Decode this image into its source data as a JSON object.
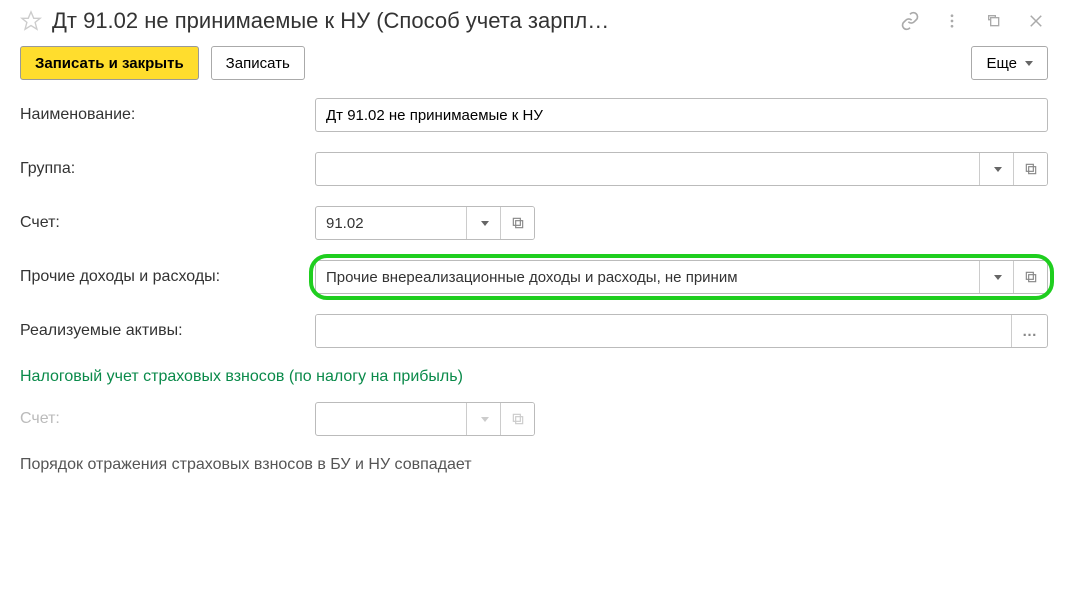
{
  "title": "Дт 91.02 не принимаемые к НУ (Способ учета зарпл…",
  "toolbar": {
    "save_close": "Записать и закрыть",
    "save": "Записать",
    "more": "Еще"
  },
  "labels": {
    "name": "Наименование:",
    "group": "Группа:",
    "account": "Счет:",
    "other_income_expense": "Прочие доходы и расходы:",
    "realizable_assets": "Реализуемые активы:",
    "tax_section": "Налоговый учет страховых взносов (по налогу на прибыль)",
    "account2": "Счет:",
    "note": "Порядок отражения страховых взносов в БУ и НУ совпадает"
  },
  "values": {
    "name": "Дт 91.02 не принимаемые к НУ",
    "group": "",
    "account": "91.02",
    "other_income_expense": "Прочие внереализационные доходы и расходы, не приним",
    "realizable_assets": "",
    "account2": ""
  }
}
